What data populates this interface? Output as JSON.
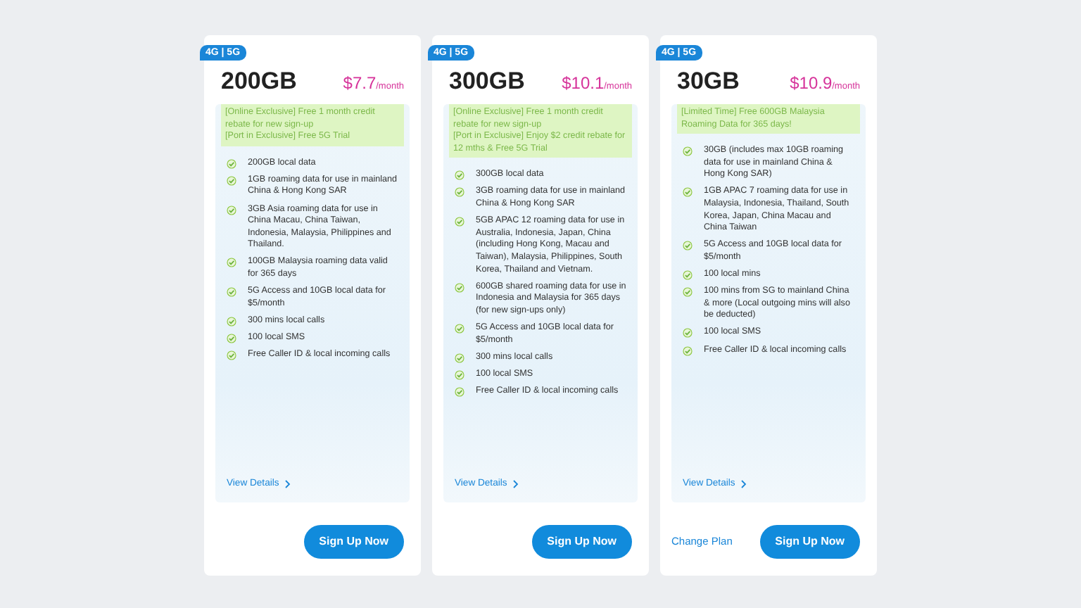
{
  "plans": [
    {
      "badge": "4G | 5G",
      "data": "200GB",
      "price": "$7.7",
      "per": "/month",
      "promos": [
        "[Online Exclusive] Free 1 month credit rebate for new sign-up",
        "[Port in Exclusive] Free 5G Trial"
      ],
      "features": [
        "200GB local data",
        "1GB roaming data for use in mainland China & Hong Kong SAR",
        "3GB Asia roaming data for use in China Macau, China Taiwan, Indonesia, Malaysia, Philippines and Thailand.",
        "100GB Malaysia roaming data valid for 365 days",
        "5G Access and 10GB local data for $5/month",
        "300 mins local calls",
        "100 local SMS",
        "Free Caller ID & local incoming calls"
      ],
      "details_link": "View Details",
      "button": "Sign Up Now"
    },
    {
      "badge": "4G | 5G",
      "data": "300GB",
      "price": "$10.1",
      "per": "/month",
      "promos": [
        "[Online Exclusive] Free 1 month credit rebate for new sign-up",
        "[Port in Exclusive] Enjoy $2 credit rebate for 12 mths & Free 5G Trial"
      ],
      "features": [
        "300GB local data",
        "3GB roaming data for use in mainland China & Hong Kong SAR",
        "5GB APAC 12 roaming data for use in Australia, Indonesia, Japan, China (including Hong Kong, Macau and Taiwan), Malaysia, Philippines, South Korea, Thailand and Vietnam.",
        "600GB shared roaming data for use in Indonesia and Malaysia for 365 days (for new sign-ups only)",
        "5G Access and 10GB local data for $5/month",
        "300 mins local calls",
        "100 local SMS",
        "Free Caller ID & local incoming calls"
      ],
      "details_link": "View Details",
      "button": "Sign Up Now"
    },
    {
      "badge": "4G | 5G",
      "data": "30GB",
      "price": "$10.9",
      "per": "/month",
      "promos": [
        "[Limited Time] Free 600GB Malaysia Roaming Data for 365 days!"
      ],
      "features": [
        "30GB (includes max 10GB roaming data for use in mainland China & Hong Kong SAR)",
        "1GB APAC 7 roaming data for use in Malaysia, Indonesia, Thailand, South Korea, Japan, China Macau and China Taiwan",
        "5G Access and 10GB local data for $5/month",
        "100 local mins",
        "100 mins from SG to mainland China & more (Local outgoing mins will also be deducted)",
        "100 local SMS",
        "Free Caller ID & local incoming calls"
      ],
      "details_link": "View Details",
      "change_link": "Change Plan",
      "button": "Sign Up Now"
    }
  ]
}
